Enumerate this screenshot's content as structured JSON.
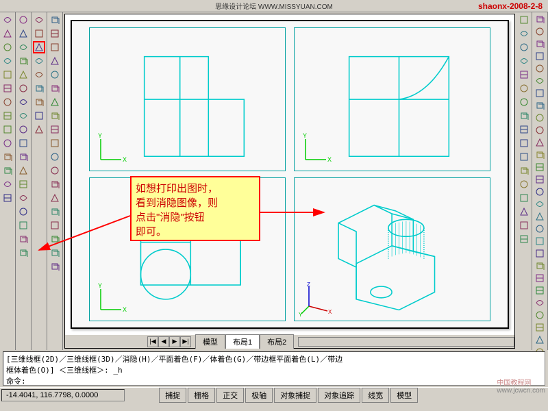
{
  "title": "思缘设计论坛 WWW.MISSYUAN.COM",
  "watermark": "shaonx-2008-2-8",
  "corner_watermark": {
    "cn": "中国教程网",
    "url": "www.jcwcn.com"
  },
  "callout": {
    "line1": "如想打印出图时，",
    "line2": "看到消隐图像，则",
    "line3": "点击\"消隐\"按钮",
    "line4": "即可。"
  },
  "tabs": {
    "nav": [
      "|◀",
      "◀",
      "▶",
      "▶|"
    ],
    "items": [
      "模型",
      "布局1",
      "布局2"
    ],
    "active_index": 1
  },
  "command": {
    "line1": "[三维线框(2D)／三维线框(3D)／消隐(H)／平面着色(F)／体着色(G)／带边框平面着色(L)／带边",
    "line2": "框体着色(O)] ＜三维线框＞: _h",
    "prompt": "命令:"
  },
  "status": {
    "coords": "-14.4041, 116.7798, 0.0000",
    "buttons": [
      "捕捉",
      "栅格",
      "正交",
      "极轴",
      "对象捕捉",
      "对象追踪",
      "线宽",
      "模型"
    ]
  },
  "left_toolbars": [
    [
      "box",
      "wedge",
      "cone",
      "sphere",
      "cylinder",
      "torus",
      "extrude",
      "revolve",
      "slice",
      "section",
      "interfere",
      "setup-dwg",
      "setup-view",
      "setup-profile"
    ],
    [
      "union",
      "subtract",
      "intersect",
      "new-block",
      "region",
      "3d-array",
      "3d-mirror",
      "3d-rotate",
      "align",
      "chamfer",
      "fillet",
      "shell",
      "imprint",
      "clean",
      "separate",
      "check",
      "render-flat",
      "render-gouraud"
    ],
    [
      "wireframe-2d",
      "wireframe-3d",
      "hidden",
      "flat-shaded",
      "gouraud-shaded",
      "flat-edges",
      "gouraud-edges",
      "realistic",
      "conceptual"
    ],
    [
      "line",
      "construction",
      "polyline",
      "polygon",
      "rectangle",
      "arc",
      "circle",
      "revcloud",
      "spline",
      "ellipse",
      "ellipse-arc",
      "insert",
      "make-block",
      "point",
      "hatch",
      "gradient",
      "region2",
      "table",
      "mtext"
    ]
  ],
  "right_toolbars": [
    [
      "erase",
      "copy",
      "mirror",
      "offset",
      "array",
      "move",
      "rotate",
      "scale",
      "stretch",
      "trim",
      "extend",
      "break-pt",
      "break",
      "join",
      "chamfer2",
      "fillet2",
      "explode"
    ],
    [
      "dist",
      "area",
      "mass",
      "list",
      "id",
      "time",
      "status2",
      "set-var",
      "purge",
      "audit",
      "recover",
      "dim-linear",
      "dim-aligned",
      "dim-arc",
      "dim-ordinate",
      "dim-radius",
      "dim-diameter",
      "dim-angular",
      "dim-quick",
      "dim-baseline",
      "dim-continue",
      "leader",
      "tolerance",
      "center",
      "dim-edit",
      "dim-tedit",
      "dim-style",
      "text-a"
    ]
  ],
  "axis": {
    "x": "X",
    "y": "Y",
    "z": "Z"
  }
}
